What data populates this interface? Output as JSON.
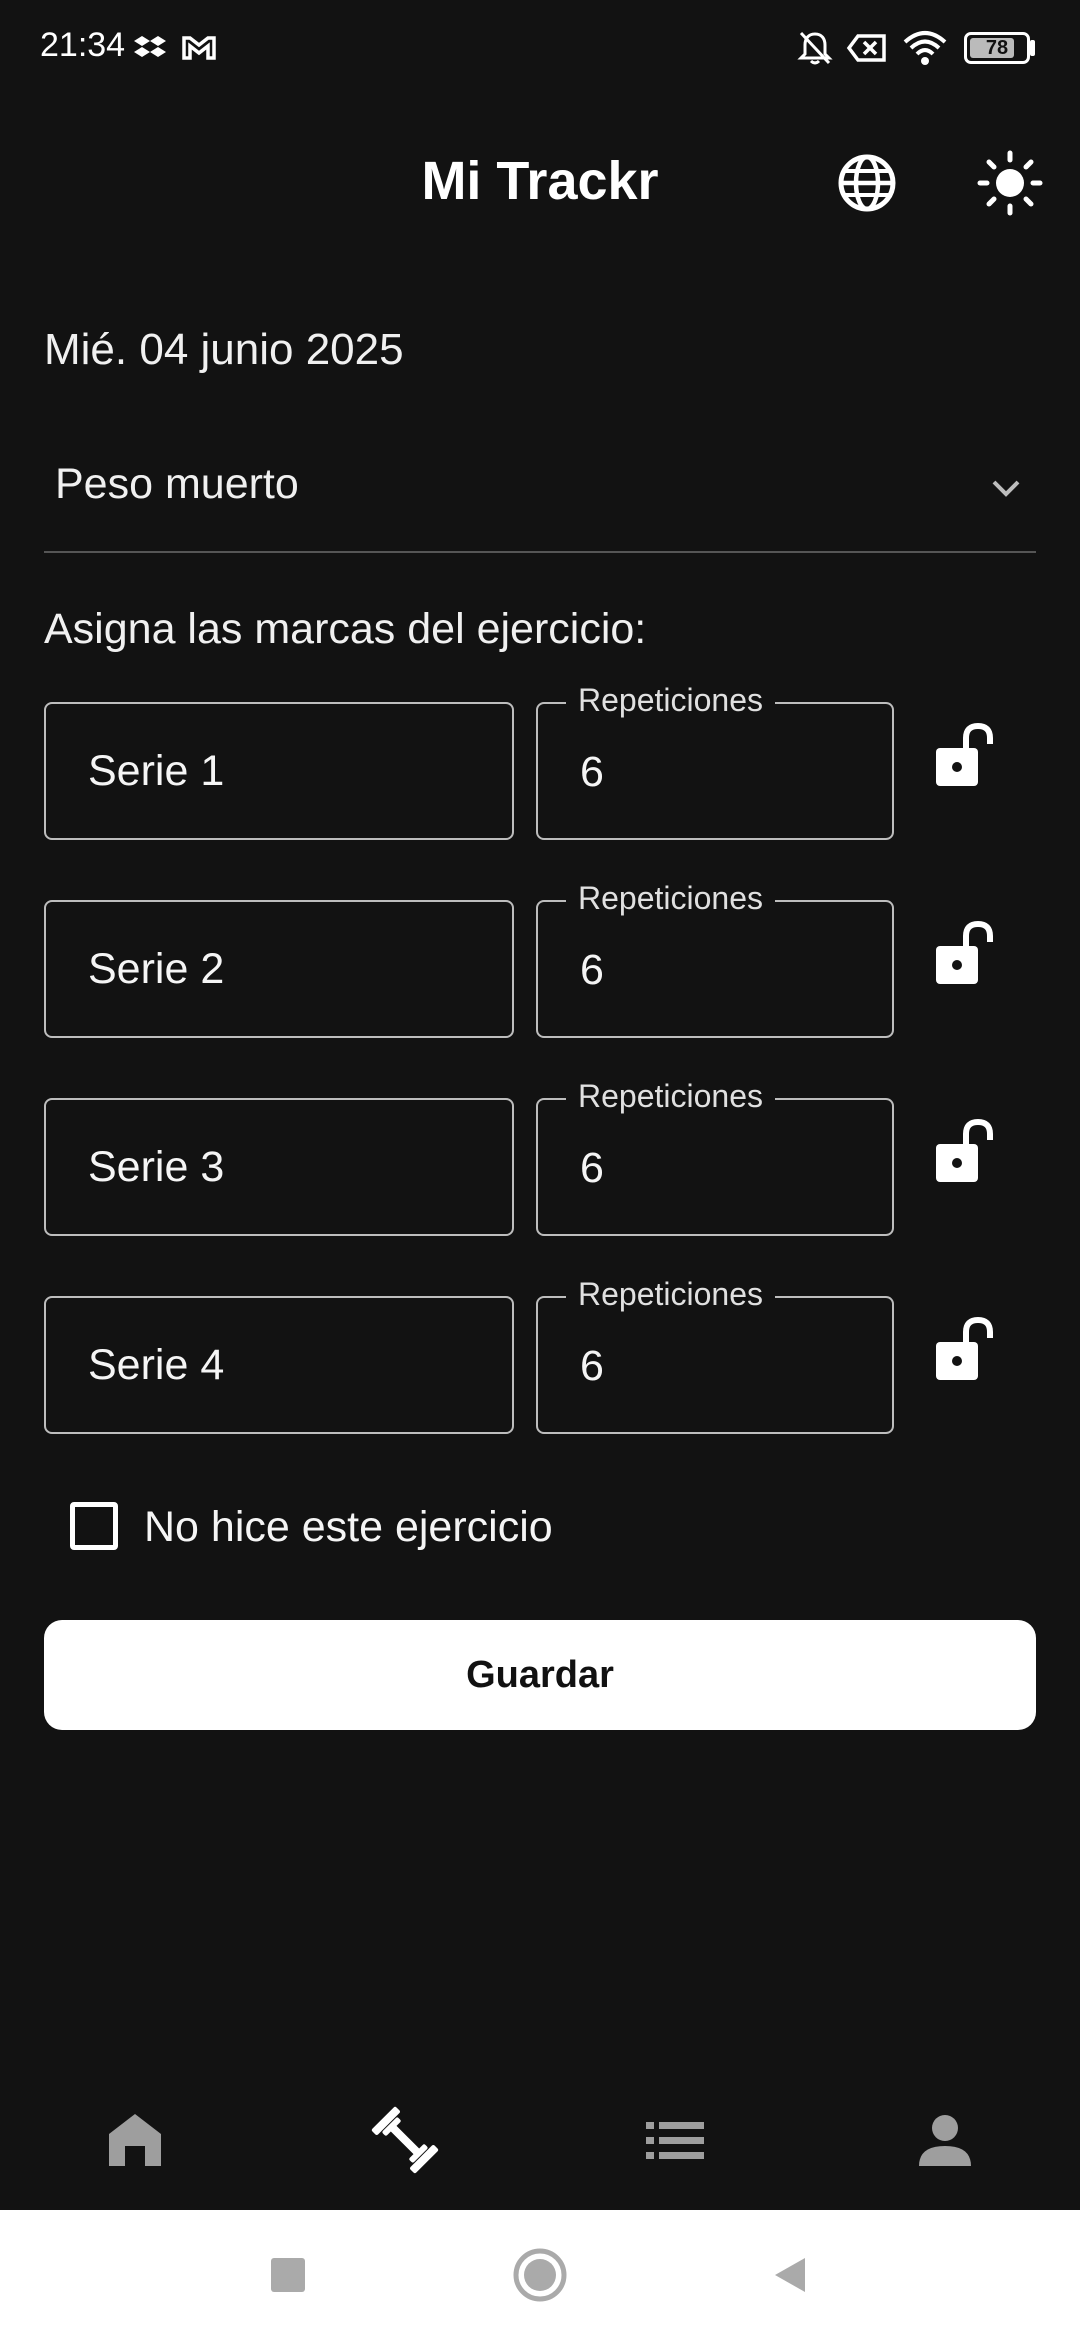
{
  "status_bar": {
    "time": "21:34",
    "battery": "78",
    "icons": [
      "dropbox-icon",
      "gmail-icon",
      "bell-off-icon",
      "no-sim-icon",
      "wifi-icon",
      "battery-icon"
    ]
  },
  "app_bar": {
    "title": "Mi Trackr",
    "actions": [
      "globe-icon",
      "sun-icon"
    ]
  },
  "date": "Mié. 04 junio 2025",
  "exercise_select": {
    "selected": "Peso muerto"
  },
  "assign_label": "Asigna las marcas del ejercicio:",
  "series": [
    {
      "name": "Serie 1",
      "reps_label": "Repeticiones",
      "reps": "6"
    },
    {
      "name": "Serie 2",
      "reps_label": "Repeticiones",
      "reps": "6"
    },
    {
      "name": "Serie 3",
      "reps_label": "Repeticiones",
      "reps": "6"
    },
    {
      "name": "Serie 4",
      "reps_label": "Repeticiones",
      "reps": "6"
    }
  ],
  "skip_checkbox": {
    "label": "No hice este ejercicio",
    "checked": false
  },
  "save_button": "Guardar",
  "bottom_nav": {
    "items": [
      "home-icon",
      "dumbbell-icon",
      "list-icon",
      "person-icon"
    ],
    "active_index": 1
  },
  "colors": {
    "background": "#121212",
    "surface_text": "#ffffff",
    "button_bg": "#ffffff",
    "inactive_nav": "#9e9e9e"
  }
}
